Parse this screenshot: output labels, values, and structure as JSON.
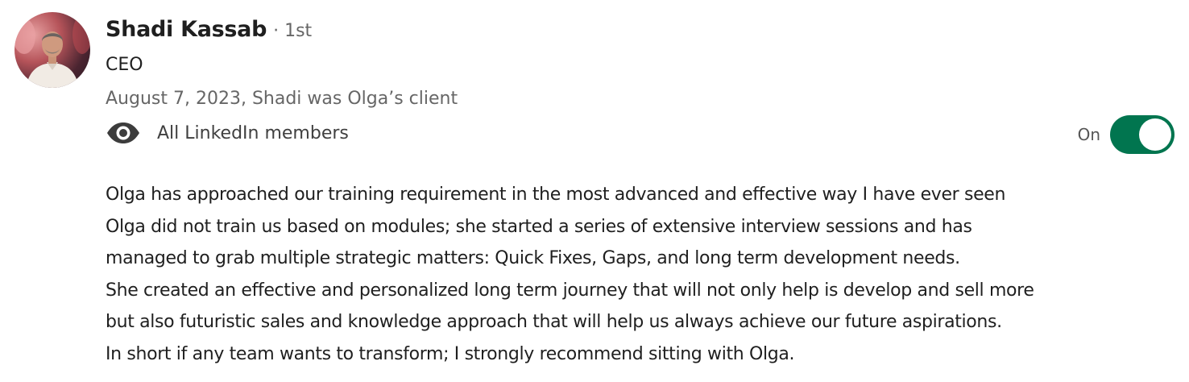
{
  "recommender": {
    "name": "Shadi Kassab",
    "degree": "· 1st",
    "headline": "CEO",
    "meta": "August 7, 2023, Shadi was Olga’s client"
  },
  "visibility": {
    "icon": "eye-icon",
    "label": "All LinkedIn members"
  },
  "toggle": {
    "label": "On",
    "state": true,
    "color": "#01754f"
  },
  "recommendation": {
    "lines": [
      "Olga has approached our training requirement in the most advanced and effective way I have ever seen",
      "Olga did not train us based on modules; she started a series of extensive interview sessions and has",
      "managed to grab multiple strategic matters: Quick Fixes, Gaps, and long term development needs.",
      "She created an effective and personalized long term journey that will not only help is develop and sell more",
      "but also futuristic sales and knowledge approach that will help us always achieve our future aspirations.",
      "In short if any team wants to transform; I strongly recommend sitting with Olga."
    ]
  }
}
